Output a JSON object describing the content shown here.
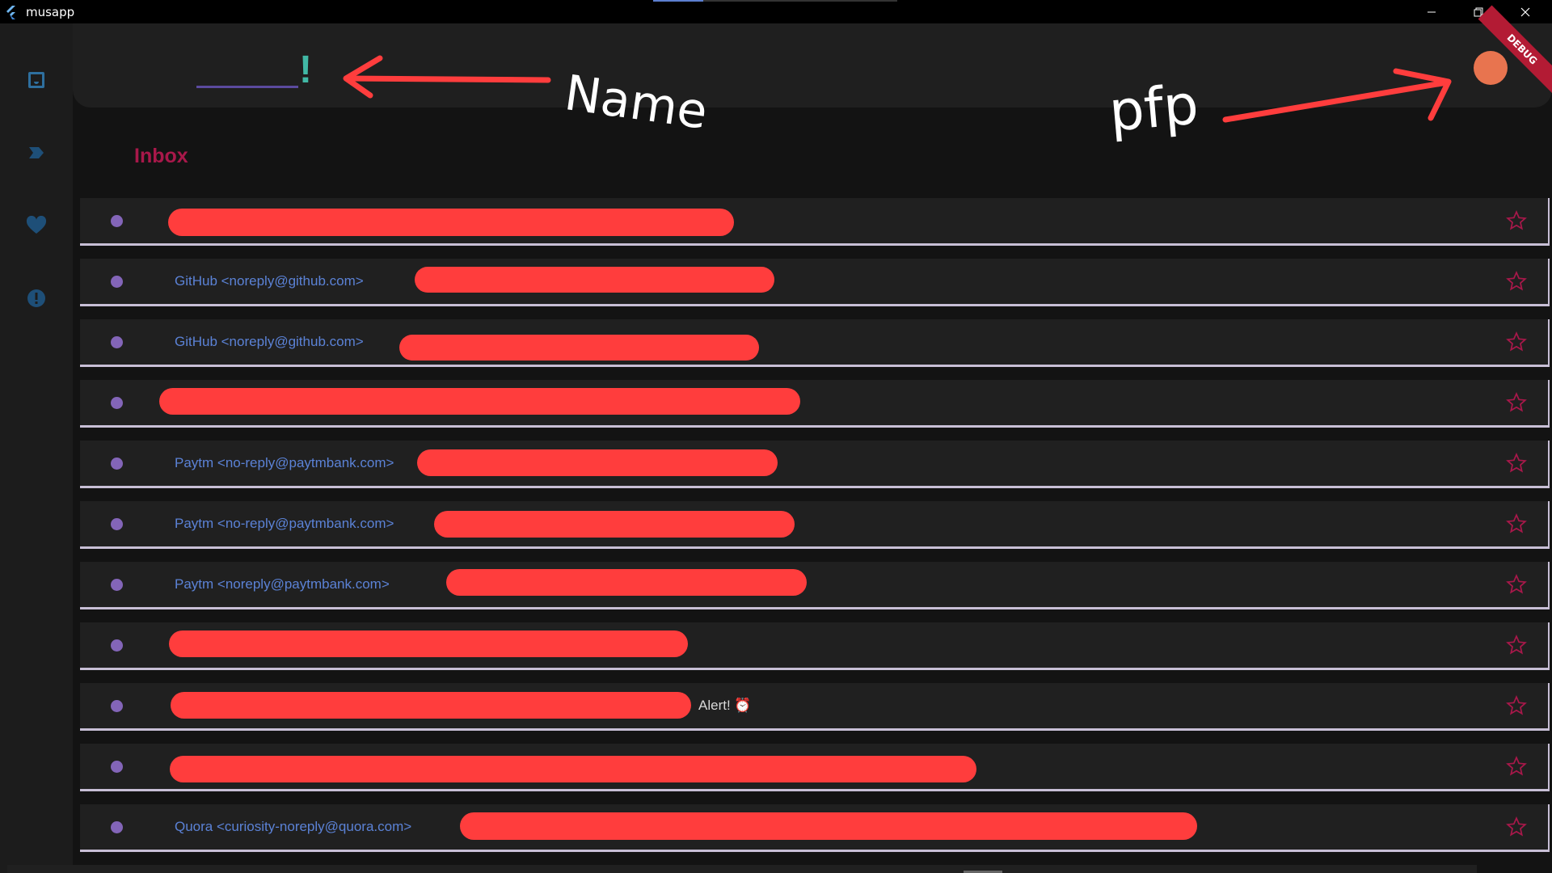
{
  "window": {
    "title": "musapp"
  },
  "header": {
    "name_suffix": "!",
    "debug_badge": "DEBUG"
  },
  "sidebar": {
    "items": [
      {
        "icon": "inbox-icon",
        "active": true
      },
      {
        "icon": "label-arrow-icon"
      },
      {
        "icon": "heart-icon"
      },
      {
        "icon": "alert-icon"
      }
    ]
  },
  "inbox": {
    "title": "Inbox",
    "emails": [
      {
        "sender": "",
        "subject": ""
      },
      {
        "sender": "GitHub <noreply@github.com>",
        "subject": ""
      },
      {
        "sender": "GitHub <noreply@github.com>",
        "subject": ""
      },
      {
        "sender": "",
        "subject": ""
      },
      {
        "sender": "Paytm <no-reply@paytmbank.com>",
        "subject": ""
      },
      {
        "sender": "Paytm <no-reply@paytmbank.com>",
        "subject": ""
      },
      {
        "sender": "Paytm <noreply@paytmbank.com>",
        "subject": ""
      },
      {
        "sender": "",
        "subject": ""
      },
      {
        "sender": "",
        "subject": "Alert! ⏰"
      },
      {
        "sender": "",
        "subject": ""
      },
      {
        "sender": "Quora <curiosity-noreply@quora.com>",
        "subject": ""
      }
    ]
  },
  "annotations": {
    "name_label": "Name",
    "pfp_label": "pfp"
  },
  "colors": {
    "accent": "#a8184a",
    "sender_link": "#5b82d6",
    "unread_dot": "#8365b8",
    "avatar": "#e8744f",
    "redaction": "#ff3d3d"
  }
}
